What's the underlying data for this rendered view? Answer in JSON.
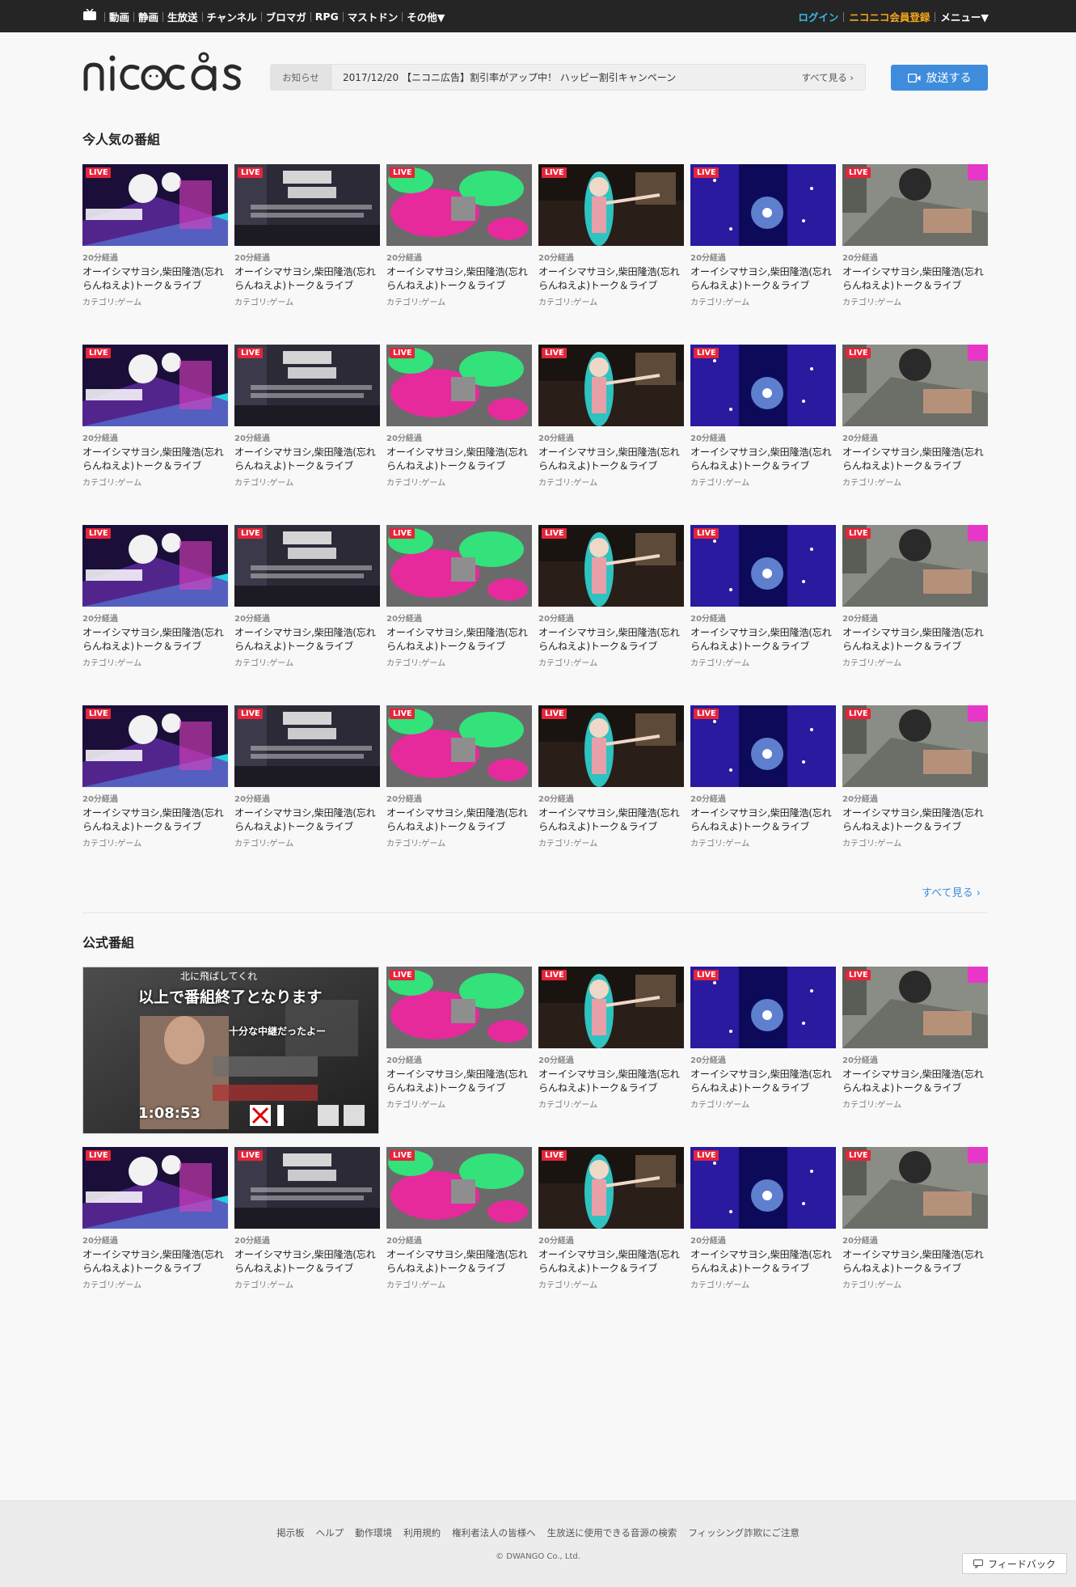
{
  "topnav": {
    "items": [
      "動画",
      "静画",
      "生放送",
      "チャンネル",
      "ブロマガ",
      "RPG",
      "マストドン",
      "その他▼"
    ],
    "login": "ログイン",
    "register": "ニコニコ会員登録",
    "menu": "メニュー▼"
  },
  "header": {
    "notice_tag": "お知らせ",
    "notice_text": "2017/12/20 【ニコニ広告】割引率がアップ中！ ハッピー割引キャンペーン",
    "notice_more": "すべて見る",
    "broadcast_button": "放送する"
  },
  "popular": {
    "title": "今人気の番組",
    "see_all": "すべて見る",
    "live_badge": "LIVE",
    "elapsed": "20分経過",
    "program_title": "オーイシマサヨシ,柴田隆浩(忘れらんねえよ)トーク＆ライブ",
    "category": "カテゴリ:ゲーム"
  },
  "official": {
    "title": "公式番組",
    "feature_time": "1:08:53",
    "feature_caption_top": "北に飛ばしてくれ",
    "feature_caption_main": "以上で番組終了となります",
    "feature_caption_sub": "十分な中継だったよー"
  },
  "footer": {
    "links": [
      "掲示板",
      "ヘルプ",
      "動作環境",
      "利用規約",
      "権利者法人の皆様へ",
      "生放送に使用できる音源の検索",
      "フィッシング詐欺にご注意"
    ],
    "copyright": "© DWANGO Co., Ltd.",
    "feedback": "フィードバック"
  }
}
